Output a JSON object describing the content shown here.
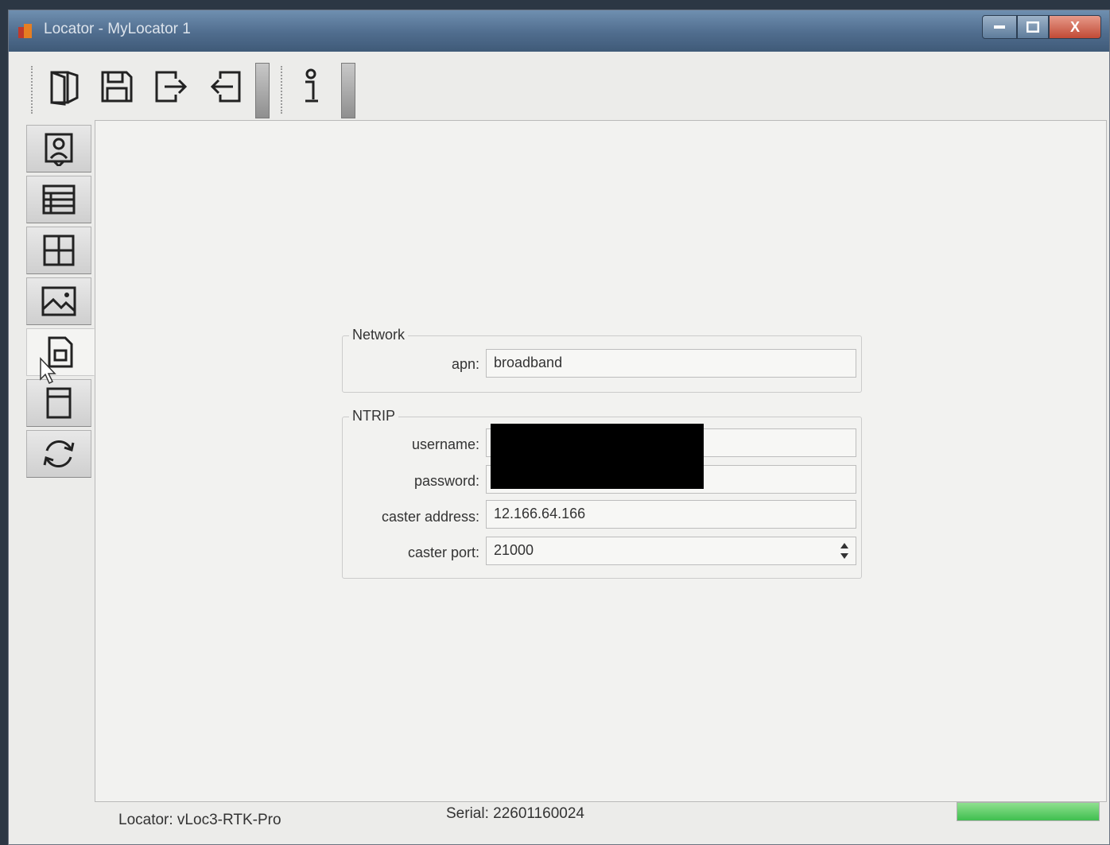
{
  "window": {
    "title": "Locator - MyLocator 1",
    "close_glyph": "X"
  },
  "toolbar": {
    "buttons": [
      {
        "name": "open-icon"
      },
      {
        "name": "save-icon"
      },
      {
        "name": "export-icon"
      },
      {
        "name": "import-icon"
      },
      {
        "name": "info-icon"
      }
    ]
  },
  "sidebar": {
    "items": [
      {
        "icon": "user-profile-icon"
      },
      {
        "icon": "list-icon"
      },
      {
        "icon": "grid-icon"
      },
      {
        "icon": "image-icon"
      },
      {
        "icon": "sim-card-icon",
        "active": true
      },
      {
        "icon": "memory-card-icon"
      },
      {
        "icon": "sync-icon"
      }
    ]
  },
  "network": {
    "title": "Network",
    "apn_label": "apn:",
    "apn_value": "broadband"
  },
  "ntrip": {
    "title": "NTRIP",
    "username_label": "username:",
    "password_label": "password:",
    "caster_address_label": "caster address:",
    "caster_address_value": "12.166.64.166",
    "caster_port_label": "caster port:",
    "caster_port_value": "21000"
  },
  "status": {
    "locator": "Locator:  vLoc3-RTK-Pro",
    "serial": "Serial:  22601160024",
    "progress": 1.0,
    "progress_color": "#3fbf4f"
  }
}
